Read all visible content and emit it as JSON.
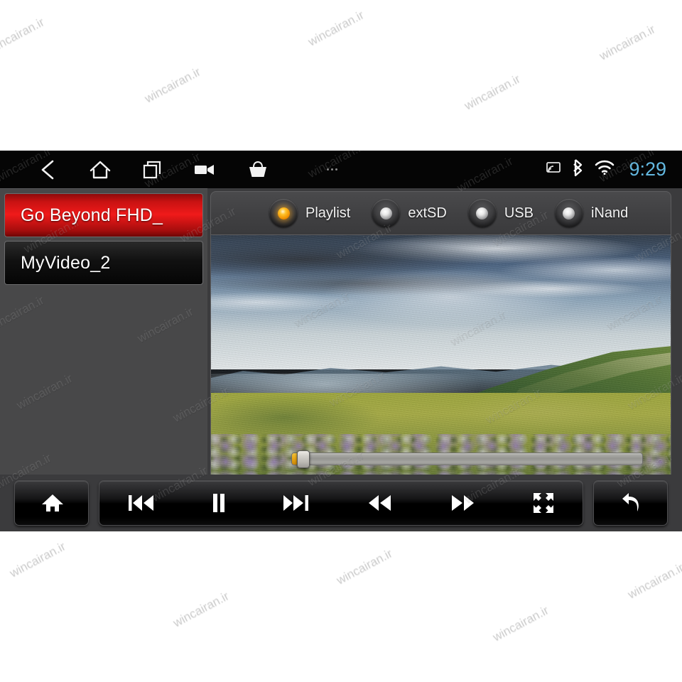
{
  "statusbar": {
    "nav": [
      {
        "name": "back-icon",
        "label": "Back"
      },
      {
        "name": "home-icon",
        "label": "Home"
      },
      {
        "name": "recent-apps-icon",
        "label": "Recent apps"
      },
      {
        "name": "video-camera-icon",
        "label": "Video"
      },
      {
        "name": "shopping-basket-icon",
        "label": "Market"
      },
      {
        "name": "overflow-menu-icon",
        "label": "More"
      }
    ],
    "indicators": [
      {
        "name": "cast-icon",
        "label": "Cast"
      },
      {
        "name": "bluetooth-icon",
        "label": "Bluetooth"
      },
      {
        "name": "wifi-icon",
        "label": "Wi-Fi"
      }
    ],
    "clock": "9:29"
  },
  "playlist": {
    "items": [
      {
        "label": "Go Beyond FHD_",
        "selected": true
      },
      {
        "label": "MyVideo_2",
        "selected": false
      }
    ]
  },
  "sources": [
    {
      "label": "Playlist",
      "active": true
    },
    {
      "label": "extSD",
      "active": false
    },
    {
      "label": "USB",
      "active": false
    },
    {
      "label": "iNand",
      "active": false
    }
  ],
  "video": {
    "scene_description": "Mountain ridge landscape with dramatic clouds, green slopes and a wildflower meadow",
    "seek": {
      "progress_percent": 2,
      "position_label": "",
      "duration_label": ""
    }
  },
  "controls": {
    "left": [
      {
        "name": "home-icon",
        "label": "Home"
      }
    ],
    "main": [
      {
        "name": "previous-track-icon",
        "label": "Previous"
      },
      {
        "name": "pause-icon",
        "label": "Pause"
      },
      {
        "name": "next-track-icon",
        "label": "Next"
      },
      {
        "name": "rewind-icon",
        "label": "Rewind"
      },
      {
        "name": "fast-forward-icon",
        "label": "Fast forward"
      },
      {
        "name": "fullscreen-icon",
        "label": "Full screen"
      }
    ],
    "right": [
      {
        "name": "return-icon",
        "label": "Return"
      }
    ]
  },
  "watermark": {
    "text": "wincairan.ir"
  },
  "colors": {
    "accent_selected": "#f01a1a",
    "led_active": "#ffc22a",
    "clock": "#63b8e0",
    "screen_background": "#3b3b3d",
    "sidebar_background": "#484849"
  }
}
